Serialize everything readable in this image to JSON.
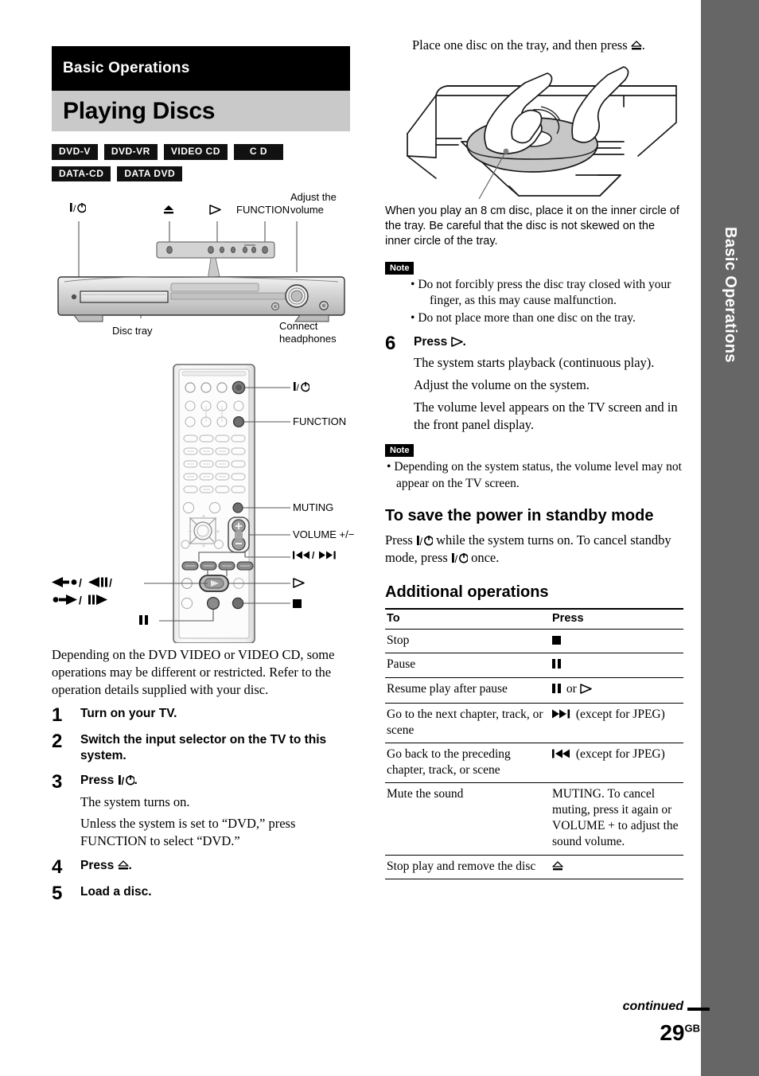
{
  "side_tab": {
    "label": "Basic Operations",
    "bg": "#666666",
    "text_color": "#ffffff"
  },
  "chapter_banner": {
    "eyebrow": "Basic Operations",
    "title": "Playing Discs",
    "eyebrow_bg": "#000000",
    "title_bg": "#c9c9c9"
  },
  "disc_badges": [
    "DVD-V",
    "DVD-VR",
    "VIDEO CD",
    "C D",
    "DATA-CD",
    "DATA DVD"
  ],
  "front_panel_figure": {
    "callouts": {
      "power": "I/⏻",
      "eject": "⏏",
      "play": "▷",
      "function": "FUNCTION",
      "adjust_volume": "Adjust the\nvolume",
      "adjust_volume_l1": "Adjust the",
      "adjust_volume_l2": "volume",
      "disc_tray": "Disc tray",
      "connect_headphones_l1": "Connect",
      "connect_headphones_l2": "headphones"
    }
  },
  "remote_figure": {
    "callouts": {
      "power": "I/⏻",
      "function": "FUNCTION",
      "muting": "MUTING",
      "volume": "VOLUME +/−",
      "skip": "|◀◀ / ▶▶|",
      "play": "▷",
      "stop": "■",
      "pause": "II",
      "scan_l1": "←• / ◀II /",
      "scan_l2": "•→ / II▶"
    }
  },
  "left_column": {
    "intro_paragraph": "Depending on the DVD VIDEO or VIDEO CD, some operations may be different or restricted. Refer to the operation details supplied with your disc.",
    "steps": [
      {
        "num": "1",
        "title": "Turn on your TV.",
        "subs": []
      },
      {
        "num": "2",
        "title": "Switch the input selector on the TV to this system.",
        "subs": []
      },
      {
        "num": "3",
        "title_pre": "Press ",
        "title_post": ".",
        "title_icon": "power-icon",
        "subs": [
          "The system turns on.",
          "Unless the system is set to “DVD,” press FUNCTION to select “DVD.”"
        ]
      },
      {
        "num": "4",
        "title_pre": "Press ",
        "title_post": ".",
        "title_icon": "eject-icon",
        "subs": []
      },
      {
        "num": "5",
        "title": "Load a disc.",
        "subs": []
      }
    ]
  },
  "right_column": {
    "lead_line_pre": "Place one disc on the tray, and then press ",
    "lead_line_post": ".",
    "lead_line_icon": "eject-icon",
    "tray_caption": "When you play an 8 cm disc, place it on the inner circle of the tray. Be careful that the disc is not skewed on the inner circle of the tray.",
    "note_label": "Note",
    "notes_first": [
      "Do not forcibly press the disc tray closed with your finger, as this may cause malfunction.",
      "Do not place more than one disc on the tray."
    ],
    "step6": {
      "num": "6",
      "title_pre": "Press ",
      "title_post": ".",
      "title_icon": "play-icon",
      "subs": [
        "The system starts playback (continuous play).",
        "Adjust the volume on the system.",
        "The volume level appears on the TV screen and in the front panel display."
      ]
    },
    "notes_second": [
      "Depending on the system status, the volume level may not appear on the TV screen."
    ],
    "standby_heading": "To save the power in standby mode",
    "standby_text_1": "Press ",
    "standby_text_2": " while the system turns on. To cancel standby mode, press ",
    "standby_text_3": " once.",
    "additional_heading": "Additional operations",
    "table": {
      "headers": [
        "To",
        "Press"
      ],
      "rows": [
        {
          "to": "Stop",
          "press_icon": "stop-icon",
          "press": ""
        },
        {
          "to": "Pause",
          "press_icon": "pause-icon",
          "press": ""
        },
        {
          "to": "Resume play after pause",
          "press_icon": "pause-then-play-icon",
          "press_mid": " or "
        },
        {
          "to": "Go to the next chapter, track, or scene",
          "press_icon": "next-icon",
          "press": " (except for JPEG)"
        },
        {
          "to": "Go back to the preceding chapter, track, or scene",
          "press_icon": "prev-icon",
          "press": " (except for JPEG)"
        },
        {
          "to": "Mute the sound",
          "press_icon": "",
          "press": "MUTING. To cancel muting, press it again or VOLUME + to adjust the sound volume."
        },
        {
          "to": "Stop play and remove the disc",
          "press_icon": "eject-icon",
          "press": ""
        }
      ]
    }
  },
  "footer": {
    "continued": "continued",
    "page_number": "29",
    "page_suffix": "GB"
  }
}
